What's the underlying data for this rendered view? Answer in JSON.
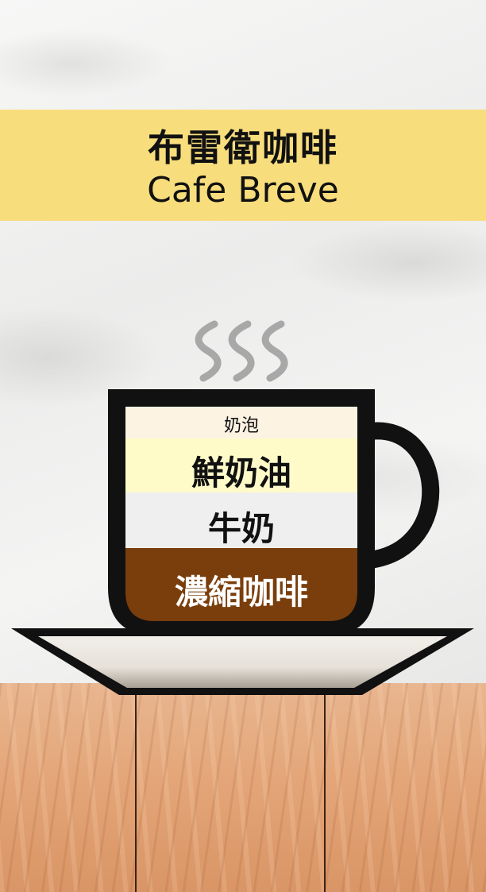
{
  "title": {
    "zh": "布雷衛咖啡",
    "en": "Cafe Breve"
  },
  "icons": {
    "steam": "steam-icon",
    "cup": "cup-icon",
    "saucer": "saucer-icon"
  },
  "colors": {
    "banner": "#f8dd7c",
    "foam": "#fdf3e3",
    "cream": "#fefbc9",
    "milk": "#efefef",
    "espresso": "#7a3e0c",
    "cup_outline": "#111111"
  },
  "layers": [
    {
      "key": "foam",
      "label": "奶泡",
      "color": "#fdf3e3"
    },
    {
      "key": "cream",
      "label": "鮮奶油",
      "color": "#fefbc9"
    },
    {
      "key": "milk",
      "label": "牛奶",
      "color": "#efefef"
    },
    {
      "key": "espresso",
      "label": "濃縮咖啡",
      "color": "#7a3e0c"
    }
  ]
}
